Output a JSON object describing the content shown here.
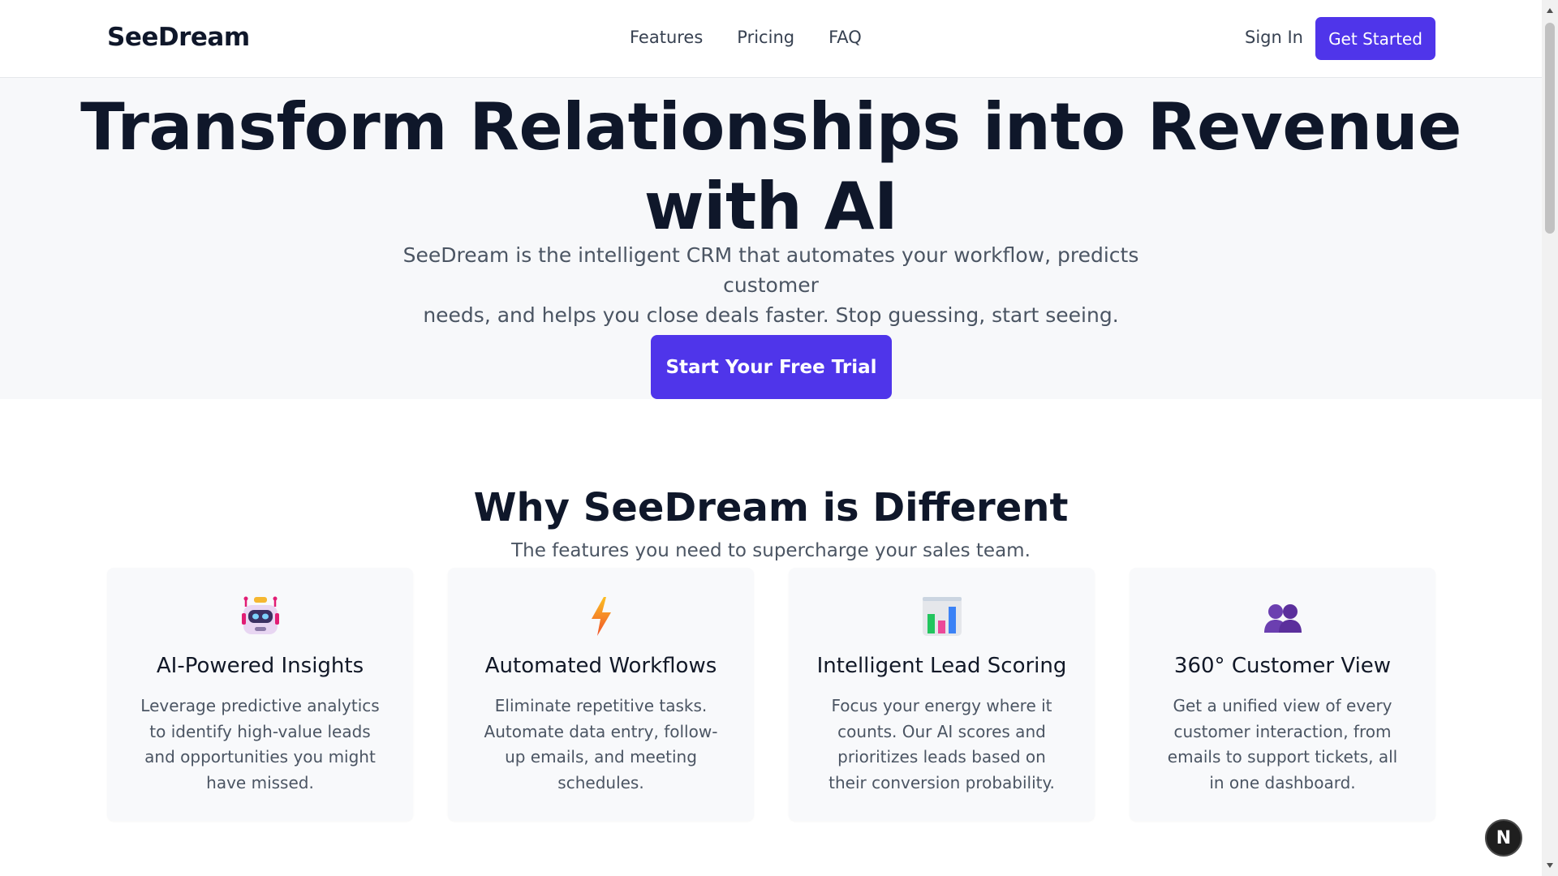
{
  "header": {
    "logo": "SeeDream",
    "nav": [
      "Features",
      "Pricing",
      "FAQ"
    ],
    "sign_in": "Sign In",
    "get_started": "Get Started"
  },
  "hero": {
    "title_line1": "Transform Relationships into Revenue",
    "title_line2": "with AI",
    "subtitle_line1": "SeeDream is the intelligent CRM that automates your workflow, predicts customer",
    "subtitle_line2": "needs, and helps you close deals faster. Stop guessing, start seeing.",
    "cta": "Start Your Free Trial"
  },
  "features": {
    "title": "Why SeeDream is Different",
    "subtitle": "The features you need to supercharge your sales team.",
    "cards": [
      {
        "icon": "robot-icon",
        "title": "AI-Powered Insights",
        "description": "Leverage predictive analytics to identify high-value leads and opportunities you might have missed."
      },
      {
        "icon": "lightning-icon",
        "title": "Automated Workflows",
        "description": "Eliminate repetitive tasks. Automate data entry, follow-up emails, and meeting schedules."
      },
      {
        "icon": "bar-chart-icon",
        "title": "Intelligent Lead Scoring",
        "description": "Focus your energy where it counts. Our AI scores and prioritizes leads based on their conversion probability."
      },
      {
        "icon": "users-icon",
        "title": "360° Customer View",
        "description": "Get a unified view of every customer interaction, from emails to support tickets, all in one dashboard."
      }
    ]
  },
  "floating_button": "N",
  "colors": {
    "accent": "#4f35ea",
    "hero_bg": "#f7f8fa",
    "card_bg": "#f8f9fb",
    "text_dark": "#0f172a",
    "text_muted": "#4b5563"
  }
}
